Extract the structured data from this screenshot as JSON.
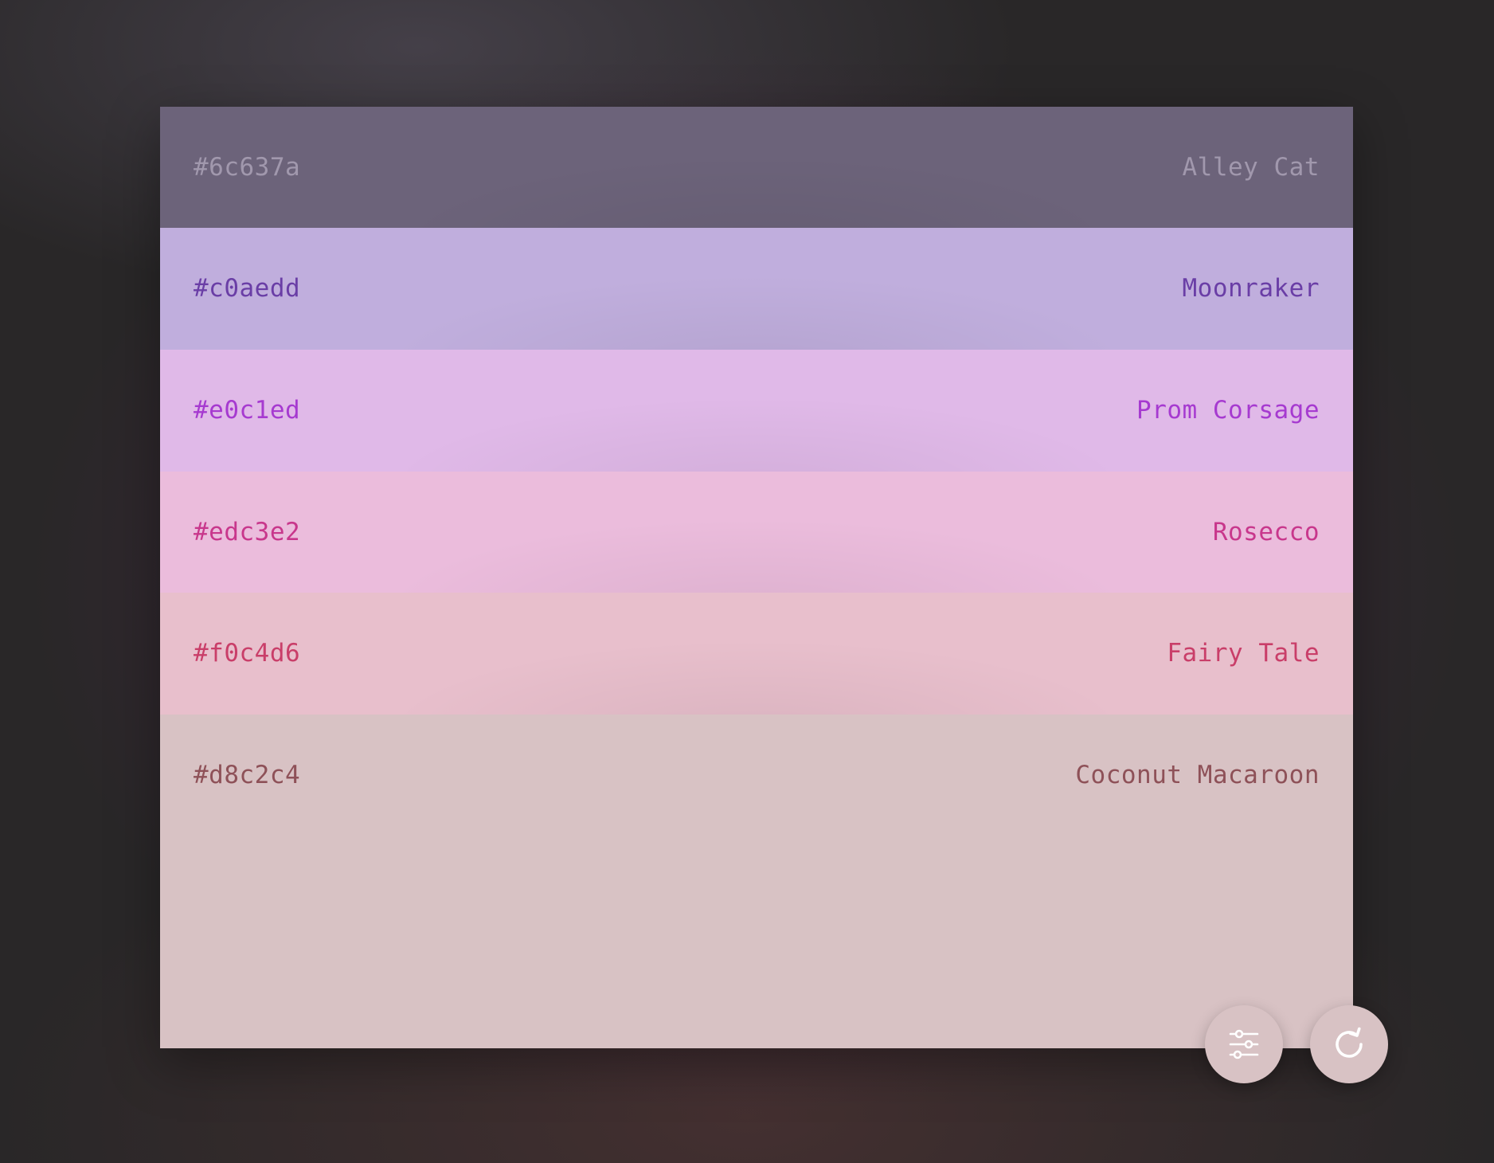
{
  "palette": {
    "swatches": [
      {
        "hex": "#6c637a",
        "name": "Alley Cat"
      },
      {
        "hex": "#c0aedd",
        "name": "Moonraker"
      },
      {
        "hex": "#e0c1ed",
        "name": "Prom Corsage"
      },
      {
        "hex": "#edc3e2",
        "name": "Rosecco"
      },
      {
        "hex": "#f0c4d6",
        "name": "Fairy Tale"
      },
      {
        "hex": "#d8c2c4",
        "name": "Coconut Macaroon"
      }
    ]
  },
  "actions": {
    "adjust_icon": "sliders-icon",
    "refresh_icon": "refresh-icon"
  },
  "colors": {
    "background": "#292728",
    "button": "#d8c2c4",
    "icon": "#ffffff"
  }
}
